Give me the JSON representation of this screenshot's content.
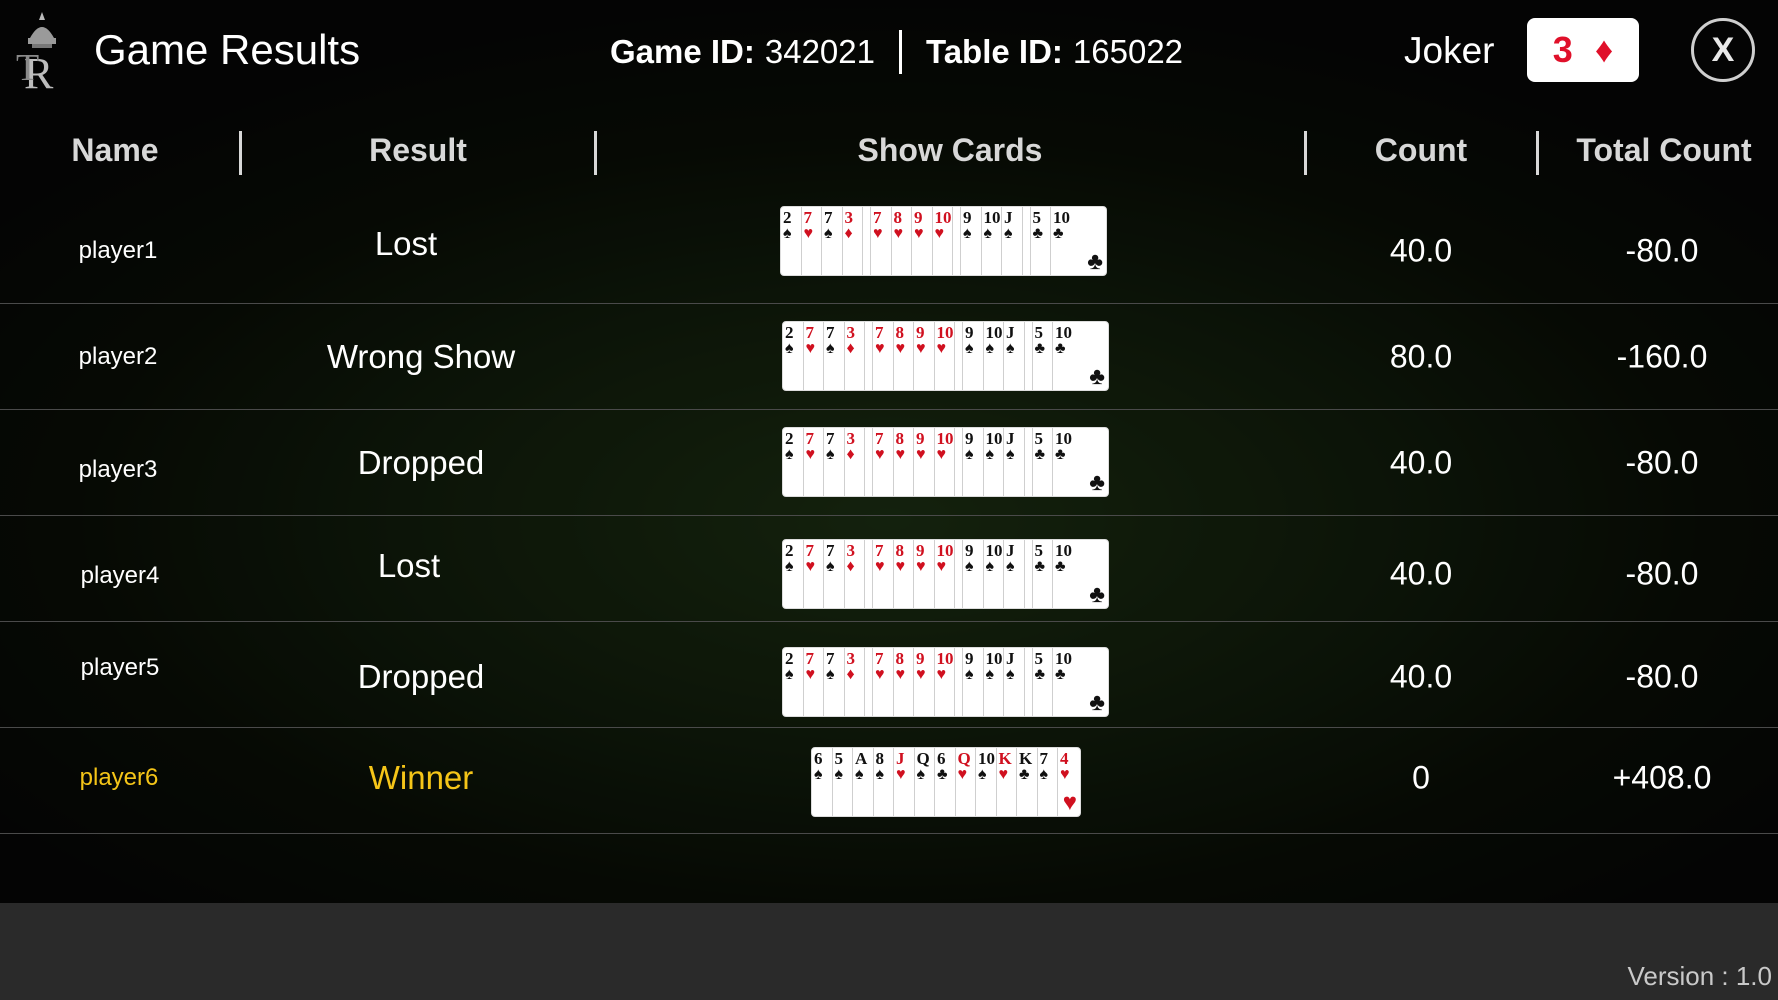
{
  "header": {
    "title": "Game Results",
    "game_id_label": "Game ID:",
    "game_id": "342021",
    "table_id_label": "Table ID:",
    "table_id": "165022",
    "joker_label": "Joker",
    "joker_rank": "3",
    "joker_suit": "♦",
    "close_label": "X"
  },
  "columns": {
    "name": "Name",
    "result": "Result",
    "show_cards": "Show Cards",
    "count": "Count",
    "total_count": "Total Count"
  },
  "rows": [
    {
      "name": "player1",
      "result": "Lost",
      "count": "40.0",
      "total": "-80.0",
      "winner": false
    },
    {
      "name": "player2",
      "result": "Wrong Show",
      "count": "80.0",
      "total": "-160.0",
      "winner": false
    },
    {
      "name": "player3",
      "result": "Dropped",
      "count": "40.0",
      "total": "-80.0",
      "winner": false
    },
    {
      "name": "player4",
      "result": "Lost",
      "count": "40.0",
      "total": "-80.0",
      "winner": false
    },
    {
      "name": "player5",
      "result": "Dropped",
      "count": "40.0",
      "total": "-80.0",
      "winner": false
    },
    {
      "name": "player6",
      "result": "Winner",
      "count": "0",
      "total": "+408.0",
      "winner": true
    }
  ],
  "hands": {
    "loser": [
      [
        {
          "r": "2",
          "s": "♠"
        },
        {
          "r": "7",
          "s": "♥"
        },
        {
          "r": "7",
          "s": "♠"
        },
        {
          "r": "3",
          "s": "♦"
        }
      ],
      [
        {
          "r": "7",
          "s": "♥"
        },
        {
          "r": "8",
          "s": "♥"
        },
        {
          "r": "9",
          "s": "♥"
        },
        {
          "r": "10",
          "s": "♥"
        }
      ],
      [
        {
          "r": "9",
          "s": "♠"
        },
        {
          "r": "10",
          "s": "♠"
        },
        {
          "r": "J",
          "s": "♠"
        }
      ],
      [
        {
          "r": "5",
          "s": "♣"
        },
        {
          "r": "10",
          "s": "♣"
        }
      ]
    ],
    "winner": [
      [
        {
          "r": "6",
          "s": "♠"
        },
        {
          "r": "5",
          "s": "♠"
        },
        {
          "r": "A",
          "s": "♠"
        },
        {
          "r": "8",
          "s": "♠"
        },
        {
          "r": "J",
          "s": "♥"
        },
        {
          "r": "Q",
          "s": "♠"
        },
        {
          "r": "6",
          "s": "♣"
        },
        {
          "r": "Q",
          "s": "♥"
        },
        {
          "r": "10",
          "s": "♠"
        },
        {
          "r": "K",
          "s": "♥"
        },
        {
          "r": "K",
          "s": "♣"
        },
        {
          "r": "7",
          "s": "♠"
        },
        {
          "r": "4",
          "s": "♥"
        }
      ]
    ]
  },
  "footer": {
    "version": "Version : 1.0"
  },
  "colors": {
    "winner": "#f5c518",
    "red_suit": "#d0101f",
    "black_suit": "#111111"
  }
}
